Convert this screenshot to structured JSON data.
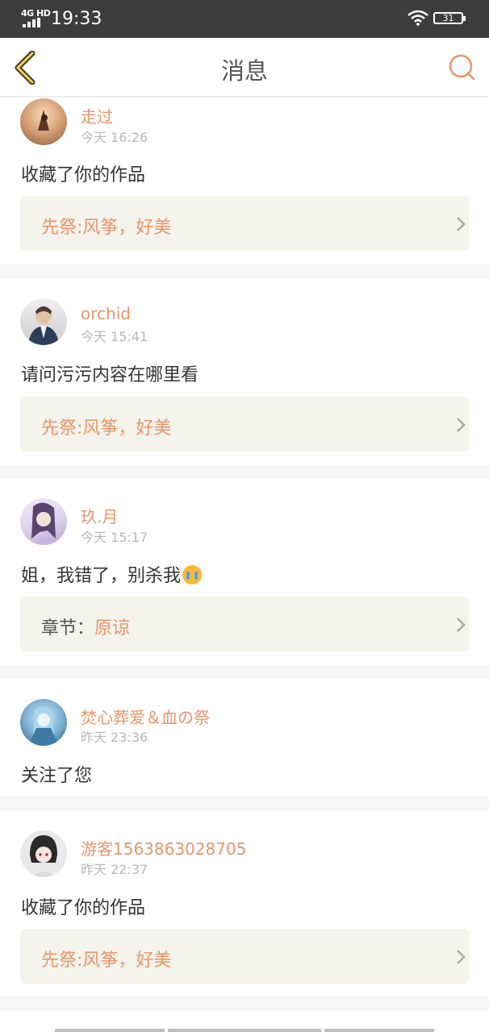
{
  "status_bar": {
    "network": "4G HD",
    "time": "19:33",
    "battery": "31"
  },
  "header": {
    "title": "消息",
    "back_icon": "chevron-left-icon",
    "search_icon": "search-icon"
  },
  "colors": {
    "accent": "#e8956b",
    "header_bar": "#3d3d3d",
    "reference_bg": "#f4f3ec"
  },
  "messages": [
    {
      "name": "走过",
      "time": "今天 16:26",
      "text": "收藏了你的作品",
      "reference": {
        "prefix": "",
        "title": "先祭:风筝，好美"
      }
    },
    {
      "name": "orchid",
      "time": "今天 15:41",
      "text": "请问污污内容在哪里看",
      "reference": {
        "prefix": "",
        "title": "先祭:风筝，好美"
      }
    },
    {
      "name": "玖.月",
      "time": "今天 15:17",
      "text": "姐，我错了，别杀我",
      "reference": {
        "prefix": "章节：",
        "title": "原谅"
      }
    },
    {
      "name": "焚心葬爱＆血の祭",
      "time": "昨天 23:36",
      "text": "关注了您"
    },
    {
      "name": "游客1563863028705",
      "time": "昨天 22:37",
      "text": "收藏了你的作品",
      "reference": {
        "prefix": "",
        "title": "先祭:风筝，好美"
      }
    }
  ]
}
